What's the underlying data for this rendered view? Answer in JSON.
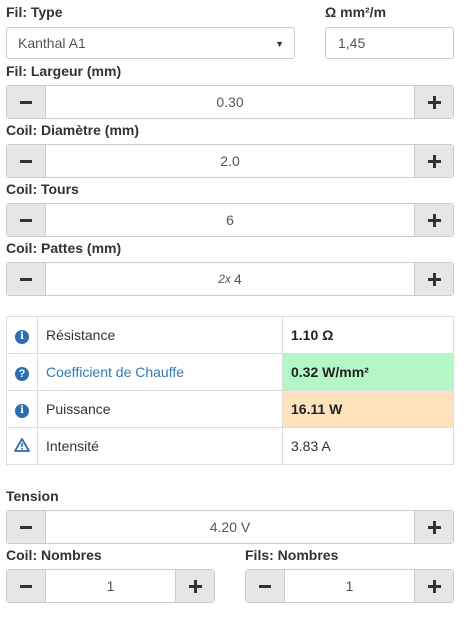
{
  "fil": {
    "type_label": "Fil: Type",
    "type_value": "Kanthal A1",
    "ohm_label": "Ω mm²/m",
    "ohm_value": "1,45",
    "largeur_label": "Fil: Largeur (mm)",
    "largeur_value": "0.30"
  },
  "coil": {
    "diametre_label": "Coil: Diamètre (mm)",
    "diametre_value": "2.0",
    "tours_label": "Coil: Tours",
    "tours_value": "6",
    "pattes_label": "Coil: Pattes (mm)",
    "pattes_prefix": "2x",
    "pattes_value": "4"
  },
  "results": {
    "rows": [
      {
        "icon": "info-icon",
        "name": "Résistance",
        "value": "1.10 Ω"
      },
      {
        "icon": "question-icon",
        "name": "Coefficient de Chauffe",
        "value": "0.32 W/mm²",
        "highlight": "#b4f7c6"
      },
      {
        "icon": "info-icon",
        "name": "Puissance",
        "value": "16.11 W",
        "highlight": "#fde3bd"
      },
      {
        "icon": "warning-icon",
        "name": "Intensité",
        "value": "3.83 A"
      }
    ]
  },
  "tension": {
    "label": "Tension",
    "value": "4.20 V"
  },
  "coil_nombres": {
    "label": "Coil: Nombres",
    "value": "1"
  },
  "fils_nombres": {
    "label": "Fils: Nombres",
    "value": "1"
  },
  "colors": {
    "accent": "#2d6db3",
    "link": "#337ab7",
    "button_bg": "#e6e6e6",
    "border": "#cccccc"
  }
}
